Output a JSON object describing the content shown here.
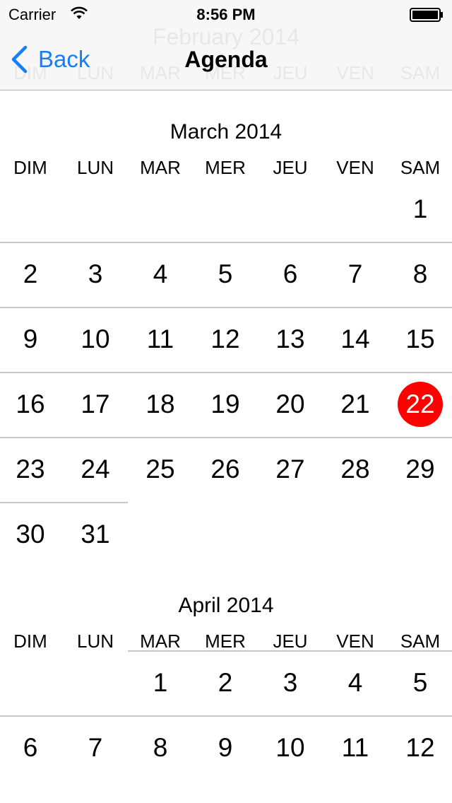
{
  "status_bar": {
    "carrier": "Carrier",
    "time": "8:56 PM"
  },
  "nav_bar": {
    "back_label": "Back",
    "title": "Agenda"
  },
  "ghost_header": {
    "month": "February 2014",
    "weekdays": [
      "DIM",
      "LUN",
      "MAR",
      "MER",
      "JEU",
      "VEN",
      "SAM"
    ]
  },
  "accent_color": "#147efb",
  "today_color": "#ff0000",
  "months": [
    {
      "title": "March 2014",
      "weekdays": [
        "DIM",
        "LUN",
        "MAR",
        "MER",
        "JEU",
        "VEN",
        "SAM"
      ],
      "first_weekday_index": 6,
      "days_in_month": 31,
      "today": 22
    },
    {
      "title": "April 2014",
      "weekdays": [
        "DIM",
        "LUN",
        "MAR",
        "MER",
        "JEU",
        "VEN",
        "SAM"
      ],
      "first_weekday_index": 2,
      "days_in_month": 12,
      "today": null
    }
  ]
}
